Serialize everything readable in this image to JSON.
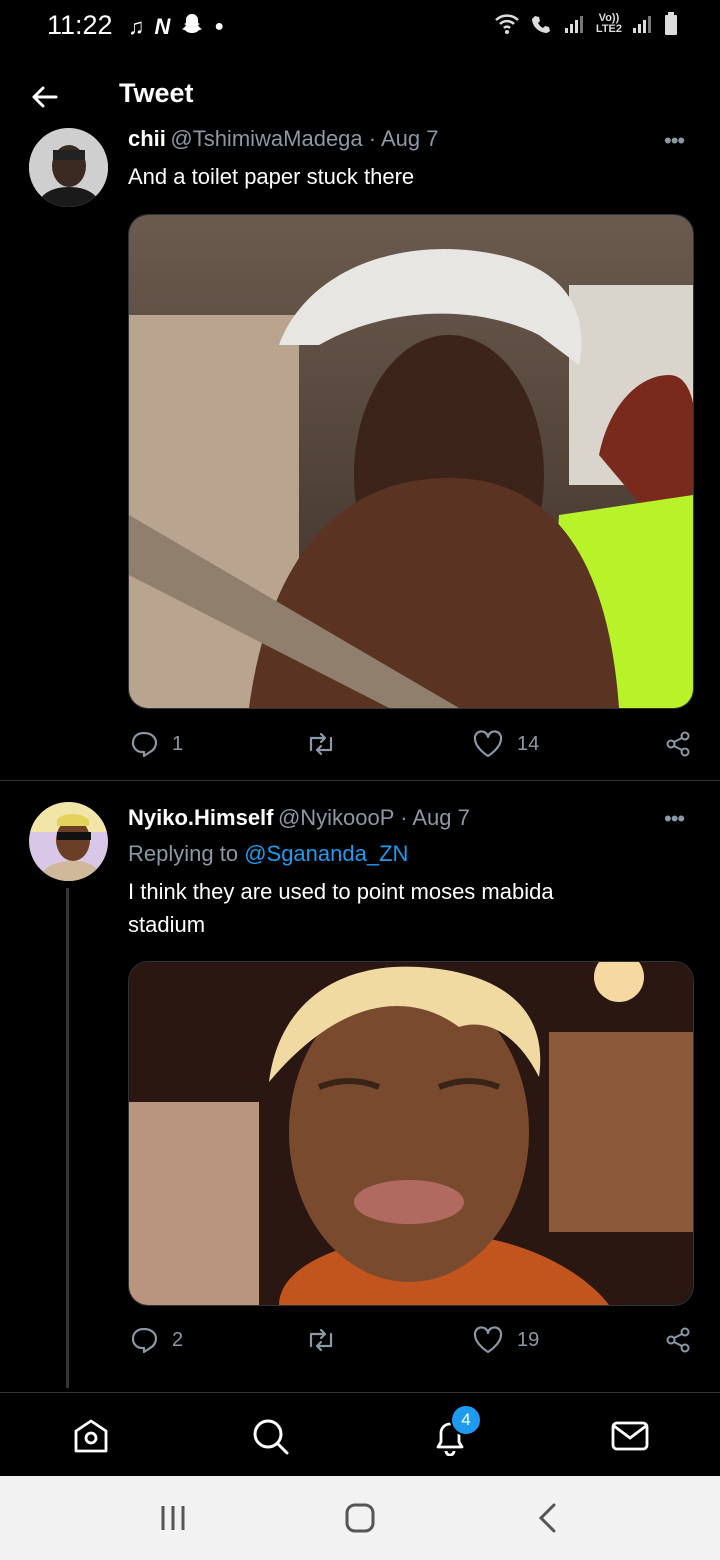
{
  "status_bar": {
    "time": "11:22",
    "network_lines": [
      "Vo))",
      "LTE2"
    ]
  },
  "header": {
    "title": "Tweet"
  },
  "tweet1": {
    "name": "chii",
    "handle_date": "@TshimiwaMadega · Aug 7",
    "text": "And a toilet paper stuck there",
    "reply_count": "1",
    "like_count": "14"
  },
  "tweet2": {
    "name": "Nyiko.Himself",
    "handle_date": "@NyikoooP · Aug 7",
    "replying_prefix": "Replying to ",
    "replying_handle": "@Sgananda_ZN",
    "text_line1": "I think they are used to point moses mabida",
    "text_line2": "stadium",
    "reply_count": "2",
    "like_count": "19"
  },
  "bottom_nav": {
    "notifications_badge": "4"
  },
  "colors": {
    "accent": "#1d9bf0",
    "muted": "#8b98a5",
    "background": "#000000"
  }
}
